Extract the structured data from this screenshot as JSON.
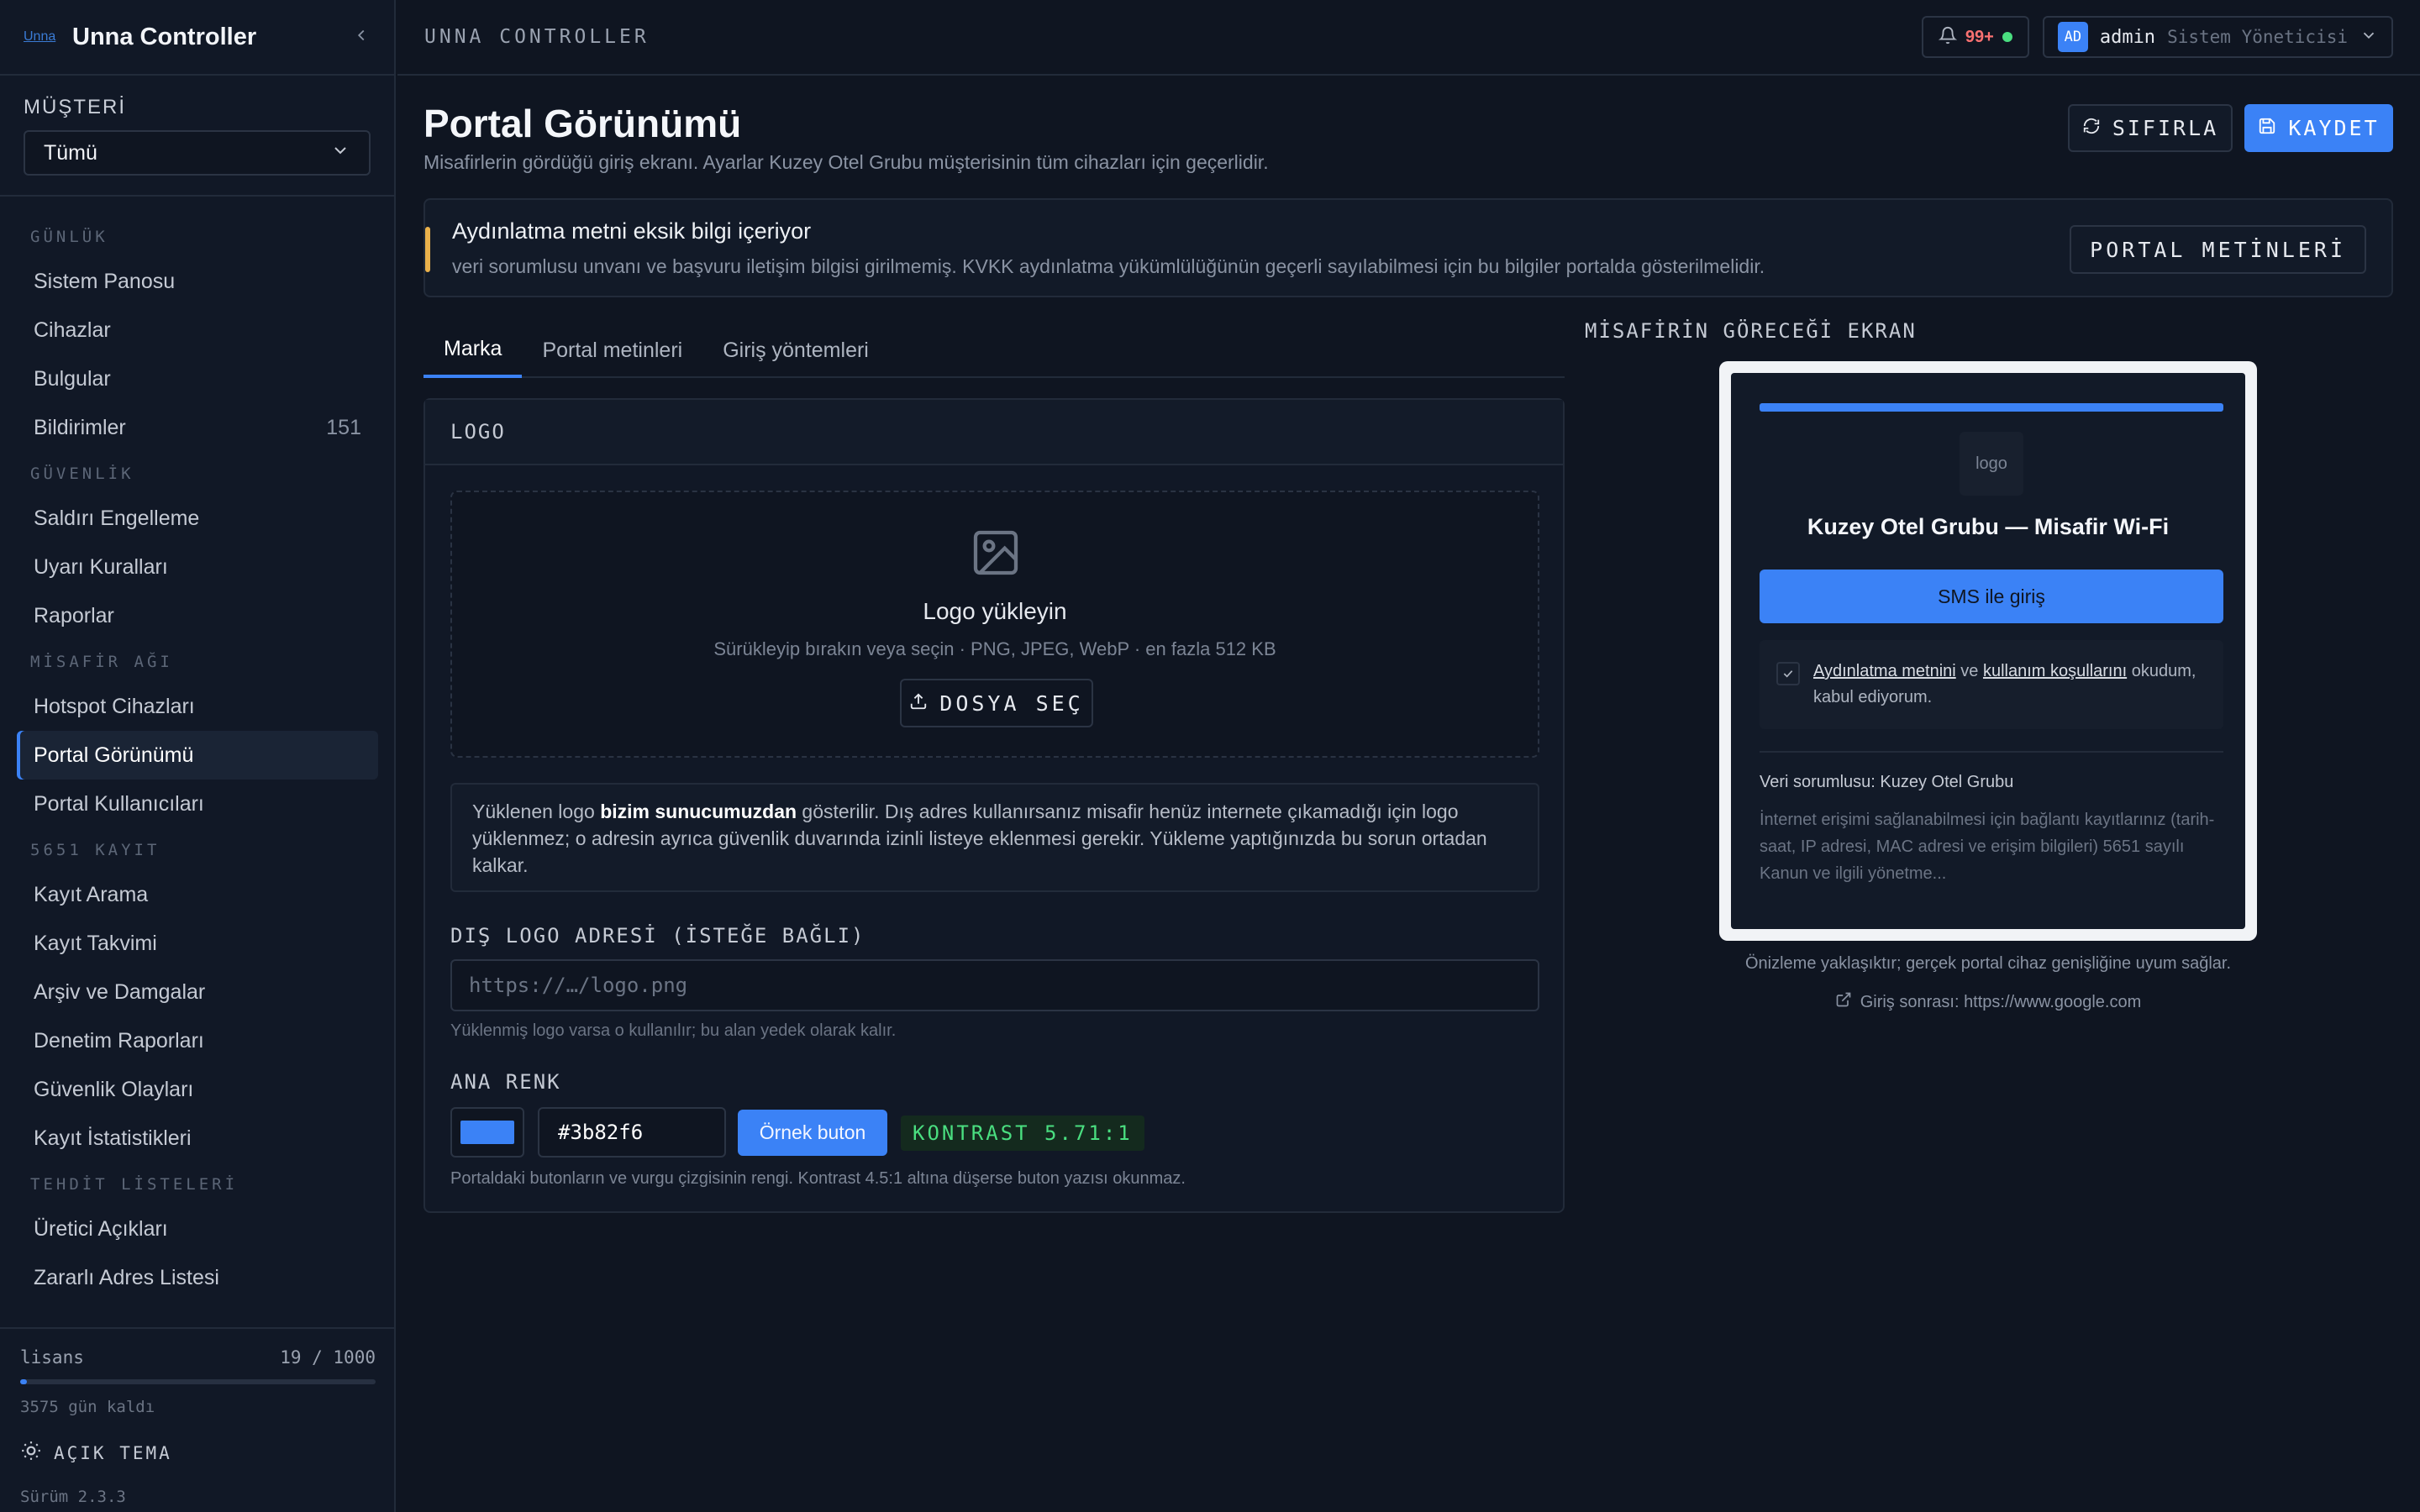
{
  "app": {
    "logo_text": "Unna",
    "title": "Unna Controller"
  },
  "sidebar": {
    "customer_label": "MÜŞTERİ",
    "customer_value": "Tümü",
    "sections": [
      {
        "label": "GÜNLÜK",
        "items": [
          {
            "label": "Sistem Panosu",
            "count": ""
          },
          {
            "label": "Cihazlar",
            "count": ""
          },
          {
            "label": "Bulgular",
            "count": ""
          },
          {
            "label": "Bildirimler",
            "count": "151"
          }
        ]
      },
      {
        "label": "GÜVENLİK",
        "items": [
          {
            "label": "Saldırı Engelleme"
          },
          {
            "label": "Uyarı Kuralları"
          },
          {
            "label": "Raporlar"
          }
        ]
      },
      {
        "label": "MİSAFİR AĞI",
        "items": [
          {
            "label": "Hotspot Cihazları"
          },
          {
            "label": "Portal Görünümü",
            "active": true
          },
          {
            "label": "Portal Kullanıcıları"
          }
        ]
      },
      {
        "label": "5651 KAYIT",
        "items": [
          {
            "label": "Kayıt Arama"
          },
          {
            "label": "Kayıt Takvimi"
          },
          {
            "label": "Arşiv ve Damgalar"
          },
          {
            "label": "Denetim Raporları"
          },
          {
            "label": "Güvenlik Olayları"
          },
          {
            "label": "Kayıt İstatistikleri"
          }
        ]
      },
      {
        "label": "TEHDİT LİSTELERİ",
        "items": [
          {
            "label": "Üretici Açıkları"
          },
          {
            "label": "Zararlı Adres Listesi"
          }
        ]
      }
    ],
    "footer": {
      "license_label": "lisans",
      "license_value": "19 / 1000",
      "license_fraction": 0.019,
      "days_left": "3575 gün kaldı",
      "theme_label": "AÇIK TEMA",
      "version": "Sürüm 2.3.3"
    }
  },
  "topbar": {
    "breadcrumb": "UNNA CONTROLLER",
    "notifications": "99+",
    "user": {
      "initials": "AD",
      "name": "admin",
      "role": "Sistem Yöneticisi"
    }
  },
  "page": {
    "title": "Portal Görünümü",
    "subtitle": "Misafirlerin gördüğü giriş ekranı. Ayarlar Kuzey Otel Grubu müşterisinin tüm cihazları için geçerlidir.",
    "reset_label": "SIFIRLA",
    "save_label": "KAYDET"
  },
  "alert": {
    "title": "Aydınlatma metni eksik bilgi içeriyor",
    "text": "veri sorumlusu unvanı ve başvuru iletişim bilgisi girilmemiş. KVKK aydınlatma yükümlülüğünün geçerli sayılabilmesi için bu bilgiler portalda gösterilmelidir.",
    "button": "PORTAL METİNLERİ"
  },
  "tabs": [
    "Marka",
    "Portal metinleri",
    "Giriş yöntemleri"
  ],
  "logo_card": {
    "header": "LOGO",
    "drop_title": "Logo yükleyin",
    "drop_hint": "Sürükleyip bırakın veya seçin · PNG, JPEG, WebP · en fazla 512 KB",
    "file_button": "DOSYA SEÇ",
    "info_pre": "Yüklenen logo ",
    "info_bold": "bizim sunucumuzdan",
    "info_post": " gösterilir. Dış adres kullanırsanız misafir henüz internete çıkamadığı için logo yüklenmez; o adresin ayrıca güvenlik duvarında izinli listeye eklenmesi gerekir. Yükleme yaptığınızda bu sorun ortadan kalkar.",
    "ext_label": "DIŞ LOGO ADRESİ (İSTEĞE BAĞLI)",
    "ext_placeholder": "https://…/logo.png",
    "ext_value": "",
    "ext_hint": "Yüklenmiş logo varsa o kullanılır; bu alan yedek olarak kalır.",
    "color_label": "ANA RENK",
    "color_value": "#3b82f6",
    "sample_button": "Örnek buton",
    "contrast": "KONTRAST 5.71:1",
    "color_hint": "Portaldaki butonların ve vurgu çizgisinin rengi. Kontrast 4.5:1 altına düşerse buton yazısı okunmaz."
  },
  "preview": {
    "label": "MİSAFİRİN GÖRECEĞİ EKRAN",
    "logo_placeholder": "logo",
    "title": "Kuzey Otel Grubu — Misafir Wi-Fi",
    "sms_button": "SMS ile giriş",
    "consent_link1": "Aydınlatma metnini",
    "consent_and": " ve ",
    "consent_link2": "kullanım koşullarını",
    "consent_tail": " okudum, kabul ediyorum.",
    "data_controller": "Veri sorumlusu: Kuzey Otel Grubu",
    "notice": "İnternet erişimi sağlanabilmesi için bağlantı kayıtlarınız (tarih-saat, IP adresi, MAC adresi ve erişim bilgileri) 5651 sayılı Kanun ve ilgili yönetme...",
    "note": "Önizleme yaklaşıktır; gerçek portal cihaz genişliğine uyum sağlar.",
    "redirect": "Giriş sonrası: https://www.google.com"
  },
  "colors": {
    "accent": "#3b82f6",
    "warning": "#eab14b",
    "success": "#4ade80",
    "danger": "#f87171"
  },
  "icons": [
    "chevron-left-icon",
    "chevron-down-icon",
    "sun-icon",
    "bell-icon",
    "refresh-icon",
    "save-icon",
    "image-icon",
    "upload-icon",
    "check-icon",
    "external-link-icon"
  ]
}
